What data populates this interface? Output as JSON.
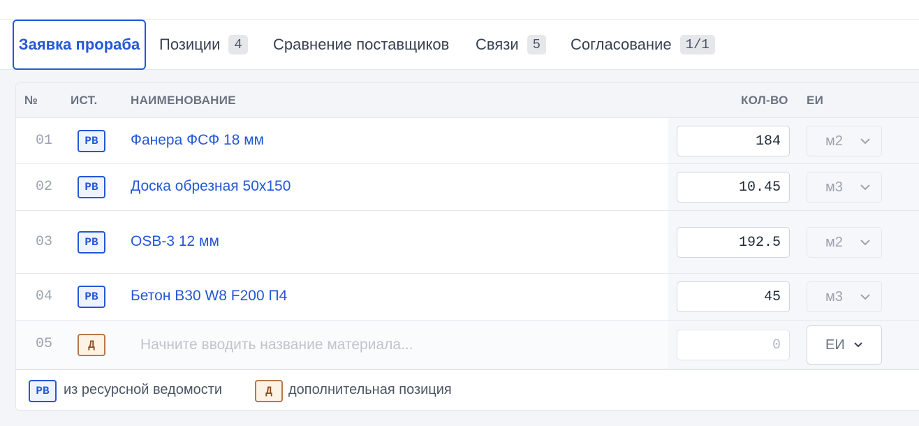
{
  "tabs": [
    {
      "label": "Заявка прораба",
      "active": true
    },
    {
      "label": "Позиции",
      "badge": "4"
    },
    {
      "label": "Сравнение поставщиков"
    },
    {
      "label": "Связи",
      "badge": "5"
    },
    {
      "label": "Согласование",
      "badge": "1/1"
    }
  ],
  "table": {
    "headers": {
      "num": "№",
      "source": "ИСТ.",
      "name": "НАИМЕНОВАНИЕ",
      "qty": "КОЛ-ВО",
      "unit": "ЕИ"
    },
    "rows": [
      {
        "num": "01",
        "source": "РВ",
        "name": "Фанера ФСФ 18 мм",
        "qty": "184",
        "unit": "м2"
      },
      {
        "num": "02",
        "source": "РВ",
        "name": "Доска обрезная 50x150",
        "qty": "10.45",
        "unit": "м3"
      },
      {
        "num": "03",
        "source": "РВ",
        "name": "OSB-3 12 мм",
        "qty": "192.5",
        "unit": "м2"
      },
      {
        "num": "04",
        "source": "РВ",
        "name": "Бетон B30 W8 F200 П4",
        "qty": "45",
        "unit": "м3"
      }
    ],
    "new_row": {
      "num": "05",
      "source": "Д",
      "name_placeholder": "Начните вводить название материала...",
      "qty_placeholder": "0",
      "unit": "ЕИ"
    }
  },
  "legend": [
    {
      "badge": "РВ",
      "text": "из ресурсной ведомости"
    },
    {
      "badge": "Д",
      "text": "дополнительная позиция"
    }
  ],
  "colors": {
    "accent": "#2358d6",
    "additional": "#8a4b22"
  },
  "icons": {
    "unit_dropdown": "chevron-down-icon"
  }
}
